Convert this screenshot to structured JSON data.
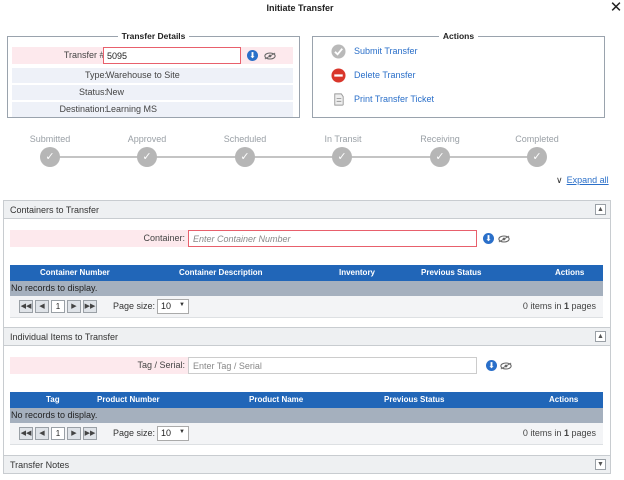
{
  "window": {
    "title": "Initiate Transfer",
    "close_glyph": "✕"
  },
  "details": {
    "legend": "Transfer Details",
    "transfer_label": "Transfer #:",
    "transfer_value": "5095",
    "type_label": "Type:",
    "type_value": "Warehouse to Site",
    "status_label": "Status:",
    "status_value": "New",
    "destination_label": "Destination:",
    "destination_value": "Learning MS"
  },
  "actions": {
    "legend": "Actions",
    "items": [
      {
        "label": "Submit Transfer",
        "icon": "check-circle-icon"
      },
      {
        "label": "Delete Transfer",
        "icon": "delete-circle-icon"
      },
      {
        "label": "Print Transfer Ticket",
        "icon": "print-ticket-icon"
      }
    ]
  },
  "steps": [
    "Submitted",
    "Approved",
    "Scheduled",
    "In Transit",
    "Receiving",
    "Completed"
  ],
  "expand_all": "Expand all",
  "containers": {
    "title": "Containers to Transfer",
    "field_label": "Container:",
    "placeholder": "Enter Container Number",
    "columns": [
      "Container Number",
      "Container Description",
      "Inventory",
      "Previous Status",
      "Actions"
    ],
    "empty": "No records to display.",
    "page": "1",
    "page_size_label": "Page size:",
    "page_size": "10",
    "pager_info_count": "0",
    "pager_info_mid": "items in",
    "pager_info_pages": "1",
    "pager_info_end": "pages"
  },
  "items": {
    "title": "Individual Items to Transfer",
    "field_label": "Tag / Serial:",
    "placeholder": "Enter Tag / Serial",
    "columns": [
      "Tag",
      "Product Number",
      "Product Name",
      "Previous Status",
      "Actions"
    ],
    "empty": "No records to display.",
    "page": "1",
    "page_size_label": "Page size:",
    "page_size": "10",
    "pager_info_count": "0",
    "pager_info_mid": "items in",
    "pager_info_pages": "1",
    "pager_info_end": "pages"
  },
  "notes": {
    "title": "Transfer Notes"
  },
  "colors": {
    "accent": "#2166b8",
    "link": "#2a6fc9",
    "error_border": "#e8606c",
    "required_bg": "#fde9ed"
  }
}
